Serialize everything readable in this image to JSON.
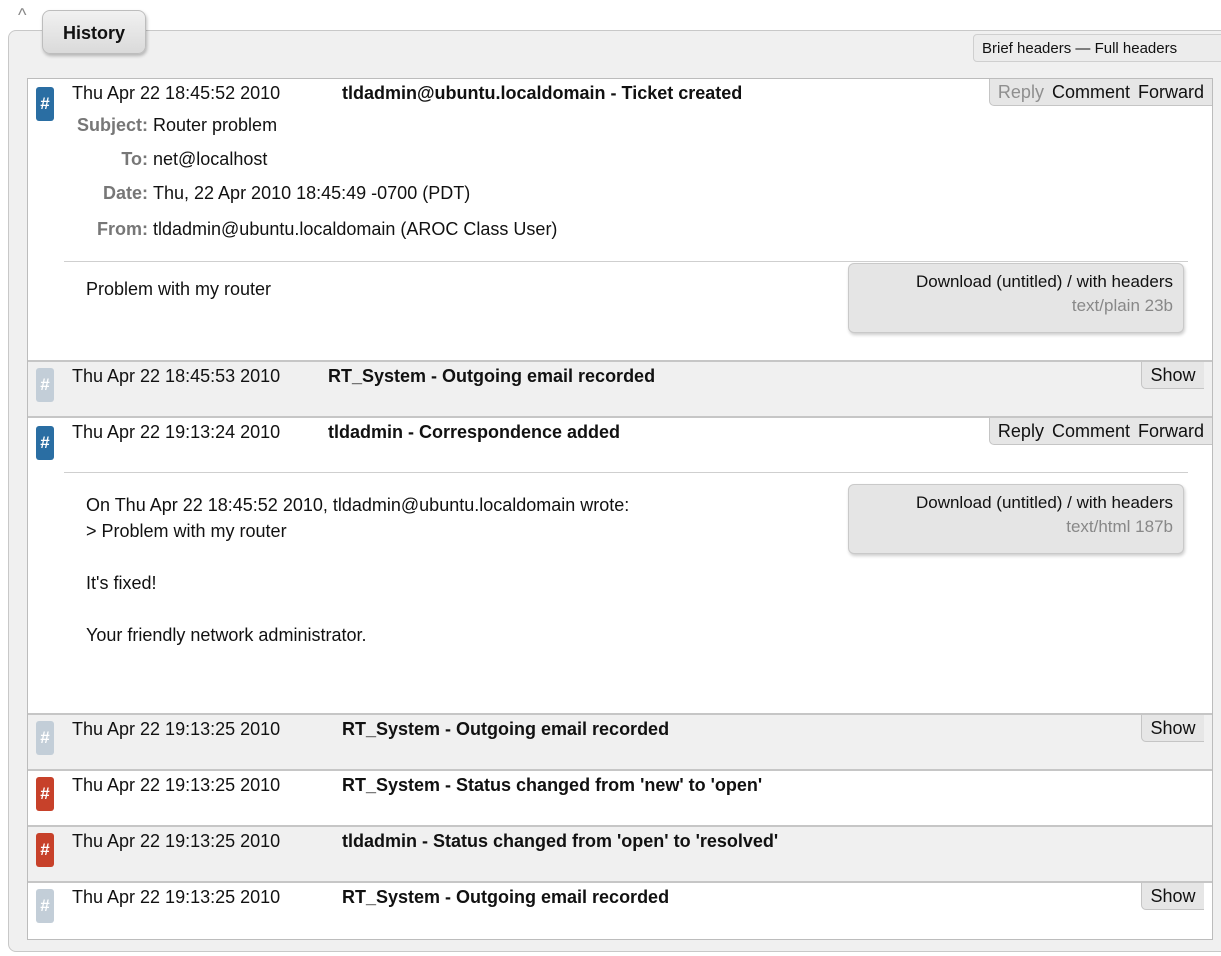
{
  "history": {
    "tab_label": "History",
    "collapse_glyph": "^",
    "header_toggle": {
      "brief": "Brief headers",
      "separator": " — ",
      "full": "Full headers"
    }
  },
  "actions": {
    "reply": "Reply",
    "comment": "Comment",
    "forward": "Forward",
    "show": "Show"
  },
  "badge_glyph": "#",
  "transactions": [
    {
      "timestamp": "Thu Apr 22 18:45:52 2010",
      "description": "tldadmin@ubuntu.localdomain - Ticket created",
      "badge_color": "#2a6ea3",
      "headers": [
        {
          "key": "Subject:",
          "value": "Router problem"
        },
        {
          "key": "To:",
          "value": "net@localhost"
        },
        {
          "key": "Date:",
          "value": "Thu, 22 Apr 2010 18:45:49 -0700 (PDT)"
        },
        {
          "key": "From:",
          "value": "tldadmin@ubuntu.localdomain (AROC Class User)"
        }
      ],
      "body": "Problem with my router",
      "download": {
        "label": "Download (untitled) / with headers",
        "meta": "text/plain 23b"
      }
    },
    {
      "timestamp": "Thu Apr 22 18:45:53 2010",
      "description": "RT_System - Outgoing email recorded",
      "badge_color": "#c3ced8"
    },
    {
      "timestamp": "Thu Apr 22 19:13:24 2010",
      "description": "tldadmin - Correspondence added",
      "badge_color": "#2a6ea3",
      "body": "On Thu Apr 22 18:45:52 2010, tldadmin@ubuntu.localdomain wrote:\n> Problem with my router\n\nIt's fixed!\n\nYour friendly network administrator.",
      "download": {
        "label": "Download (untitled) / with headers",
        "meta": "text/html 187b"
      }
    },
    {
      "timestamp": "Thu Apr 22 19:13:25 2010",
      "description": "RT_System - Outgoing email recorded",
      "badge_color": "#c3ced8"
    },
    {
      "timestamp": "Thu Apr 22 19:13:25 2010",
      "description": "RT_System - Status changed from 'new' to 'open'",
      "badge_color": "#c7412a"
    },
    {
      "timestamp": "Thu Apr 22 19:13:25 2010",
      "description": "tldadmin - Status changed from 'open' to 'resolved'",
      "badge_color": "#c7412a"
    },
    {
      "timestamp": "Thu Apr 22 19:13:25 2010",
      "description": "RT_System - Outgoing email recorded",
      "badge_color": "#c3ced8"
    }
  ]
}
